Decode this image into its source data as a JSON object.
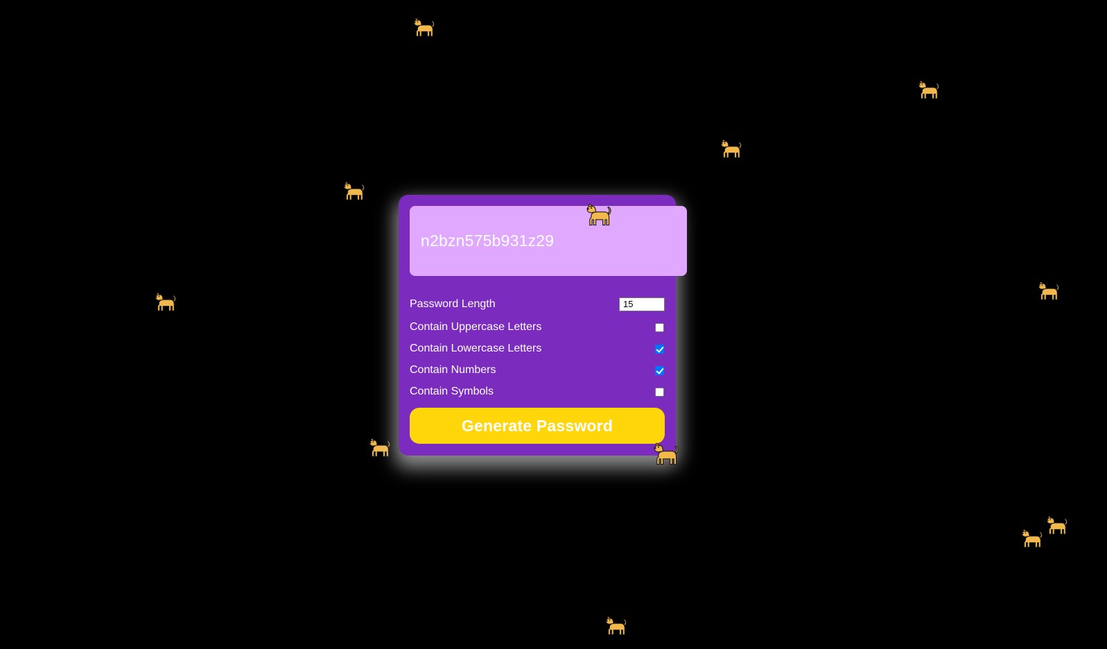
{
  "generator": {
    "password_value": "n2bzn575b931z29",
    "length_label": "Password Length",
    "length_value": "15",
    "options": [
      {
        "label": "Contain Uppercase Letters",
        "checked": false
      },
      {
        "label": "Contain Lowercase Letters",
        "checked": true
      },
      {
        "label": "Contain Numbers",
        "checked": true
      },
      {
        "label": "Contain Symbols",
        "checked": false
      }
    ],
    "generate_label": "Generate Password"
  },
  "decorations": {
    "icon": "dog-icon",
    "count": 14
  },
  "colors": {
    "background": "#000000",
    "card": "#7b2cbf",
    "result_box": "#e0a8ff",
    "button": "#ffd60a",
    "dog": "#f2b84b"
  }
}
